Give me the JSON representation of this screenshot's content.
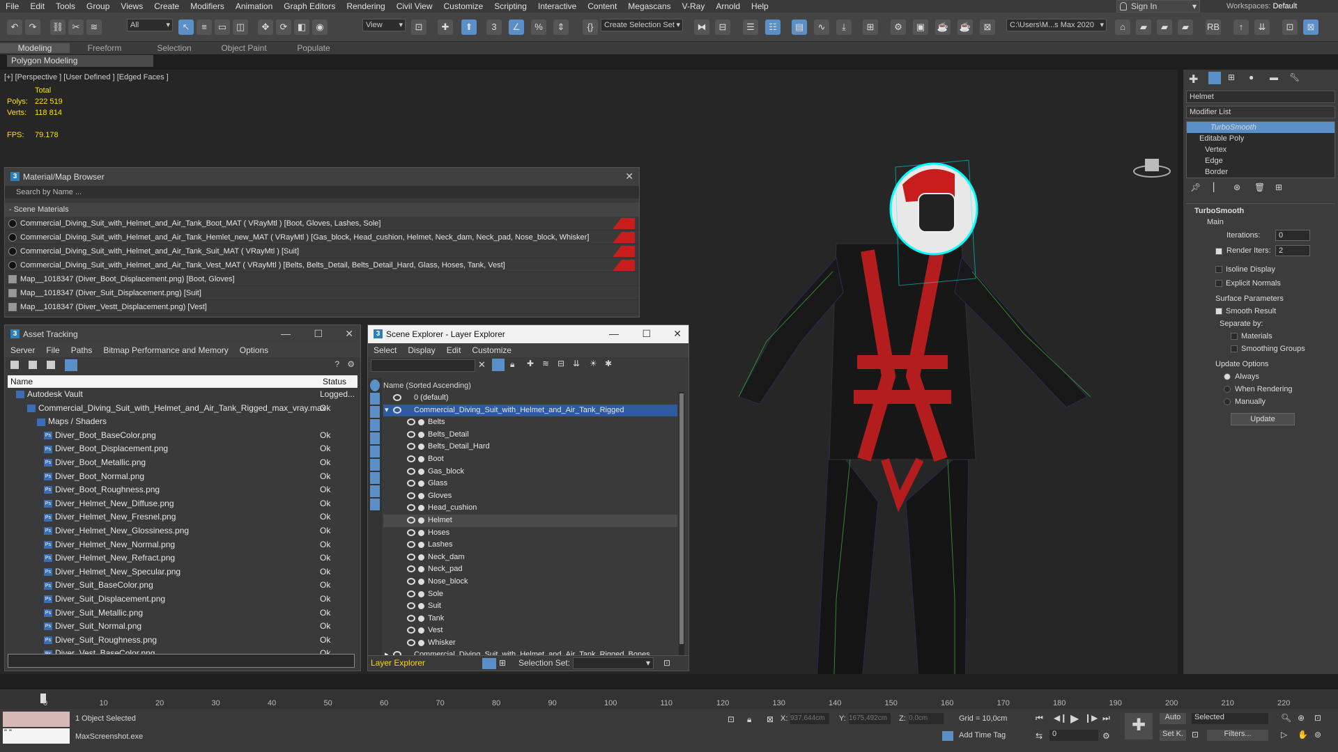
{
  "menu": [
    "File",
    "Edit",
    "Tools",
    "Group",
    "Views",
    "Create",
    "Modifiers",
    "Animation",
    "Graph Editors",
    "Rendering",
    "Civil View",
    "Customize",
    "Scripting",
    "Interactive",
    "Content",
    "Megascans",
    "V-Ray",
    "Arnold",
    "Help"
  ],
  "signin": "Sign In",
  "workspaces": "Workspaces:",
  "workspace_value": "Default",
  "toolbar": {
    "filter": "All",
    "view": "View",
    "selection_set": "Create Selection Set",
    "path": "C:\\Users\\M...s Max 2020"
  },
  "ribbon": {
    "tabs": [
      "Modeling",
      "Freeform",
      "Selection",
      "Object Paint",
      "Populate"
    ],
    "active": "Modeling",
    "subpanel": "Polygon Modeling"
  },
  "viewport": {
    "label": "[+] [Perspective ] [User Defined ] [Edged Faces ]",
    "stats_header": "Total",
    "polys_label": "Polys:",
    "polys": "222 519",
    "verts_label": "Verts:",
    "verts": "118 814",
    "fps_label": "FPS:",
    "fps": "79.178"
  },
  "material_browser": {
    "title": "Material/Map Browser",
    "search": "Search by Name ...",
    "section": "- Scene Materials",
    "items": [
      "Commercial_Diving_Suit_with_Helmet_and_Air_Tank_Boot_MAT  ( VRayMtl )  [Boot, Gloves, Lashes, Sole]",
      "Commercial_Diving_Suit_with_Helmet_and_Air_Tank_Hemlet_new_MAT  ( VRayMtl )  [Gas_block, Head_cushion, Helmet, Neck_dam, Neck_pad, Nose_block, Whisker]",
      "Commercial_Diving_Suit_with_Helmet_and_Air_Tank_Suit_MAT  ( VRayMtl )  [Suit]",
      "Commercial_Diving_Suit_with_Helmet_and_Air_Tank_Vest_MAT  ( VRayMtl )  [Belts, Belts_Detail, Belts_Detail_Hard, Glass, Hoses, Tank, Vest]",
      "Map__1018347 (Diver_Boot_Displacement.png)  [Boot, Gloves]",
      "Map__1018347 (Diver_Suit_Displacement.png)  [Suit]",
      "Map__1018347 (Diver_Vestt_Displacement.png)  [Vest]"
    ]
  },
  "asset_tracking": {
    "title": "Asset Tracking",
    "menu": [
      "Server",
      "File",
      "Paths",
      "Bitmap Performance and Memory",
      "Options"
    ],
    "col_name": "Name",
    "col_status": "Status",
    "rows": [
      {
        "name": "Autodesk Vault",
        "status": "Logged..."
      },
      {
        "name": "Commercial_Diving_Suit_with_Helmet_and_Air_Tank_Rigged_max_vray.max",
        "status": "Ok"
      },
      {
        "name": "Maps / Shaders",
        "status": ""
      },
      {
        "name": "Diver_Boot_BaseColor.png",
        "status": "Ok"
      },
      {
        "name": "Diver_Boot_Displacement.png",
        "status": "Ok"
      },
      {
        "name": "Diver_Boot_Metallic.png",
        "status": "Ok"
      },
      {
        "name": "Diver_Boot_Normal.png",
        "status": "Ok"
      },
      {
        "name": "Diver_Boot_Roughness.png",
        "status": "Ok"
      },
      {
        "name": "Diver_Helmet_New_Diffuse.png",
        "status": "Ok"
      },
      {
        "name": "Diver_Helmet_New_Fresnel.png",
        "status": "Ok"
      },
      {
        "name": "Diver_Helmet_New_Glossiness.png",
        "status": "Ok"
      },
      {
        "name": "Diver_Helmet_New_Normal.png",
        "status": "Ok"
      },
      {
        "name": "Diver_Helmet_New_Refract.png",
        "status": "Ok"
      },
      {
        "name": "Diver_Helmet_New_Specular.png",
        "status": "Ok"
      },
      {
        "name": "Diver_Suit_BaseColor.png",
        "status": "Ok"
      },
      {
        "name": "Diver_Suit_Displacement.png",
        "status": "Ok"
      },
      {
        "name": "Diver_Suit_Metallic.png",
        "status": "Ok"
      },
      {
        "name": "Diver_Suit_Normal.png",
        "status": "Ok"
      },
      {
        "name": "Diver_Suit_Roughness.png",
        "status": "Ok"
      },
      {
        "name": "Diver_Vest_BaseColor.png",
        "status": "Ok"
      }
    ]
  },
  "scene_explorer": {
    "title": "Scene Explorer - Layer Explorer",
    "menu": [
      "Select",
      "Display",
      "Edit",
      "Customize"
    ],
    "header": "Name (Sorted Ascending)",
    "layer0": "0 (default)",
    "group": "Commercial_Diving_Suit_with_Helmet_and_Air_Tank_Rigged",
    "items": [
      "Belts",
      "Belts_Detail",
      "Belts_Detail_Hard",
      "Boot",
      "Gas_block",
      "Glass",
      "Gloves",
      "Head_cushion",
      "Helmet",
      "Hoses",
      "Lashes",
      "Neck_dam",
      "Neck_pad",
      "Nose_block",
      "Sole",
      "Suit",
      "Tank",
      "Vest",
      "Whisker"
    ],
    "selected": "Helmet",
    "bones": "Commercial_Diving_Suit_with_Helmet_and_Air_Tank_Rigged_Bones",
    "footer_layer": "Layer Explorer",
    "selection_set": "Selection Set:"
  },
  "command_panel": {
    "object_name": "Helmet",
    "modifier_list": "Modifier List",
    "stack": [
      "TurboSmooth",
      "Editable Poly",
      "Vertex",
      "Edge",
      "Border"
    ],
    "rollout": "TurboSmooth",
    "main": "Main",
    "iterations_label": "Iterations:",
    "iterations": "0",
    "render_iters_label": "Render Iters:",
    "render_iters": "2",
    "isoline": "Isoline Display",
    "explicit": "Explicit Normals",
    "surface": "Surface Parameters",
    "smooth": "Smooth Result",
    "separate": "Separate by:",
    "materials": "Materials",
    "smoothing": "Smoothing Groups",
    "update_options": "Update Options",
    "always": "Always",
    "when_rendering": "When Rendering",
    "manually": "Manually",
    "update": "Update"
  },
  "timeline": {
    "ticks": [
      "0",
      "10",
      "20",
      "30",
      "40",
      "50",
      "60",
      "70",
      "80",
      "90",
      "100",
      "110",
      "120",
      "130",
      "140",
      "150",
      "160",
      "170",
      "180",
      "190",
      "200",
      "210",
      "220"
    ]
  },
  "status": {
    "selected": "1 Object Selected",
    "script": "MaxScreenshot.exe",
    "x_label": "X:",
    "x": "937,644cm",
    "y_label": "Y:",
    "y": "1675,492cm",
    "z_label": "Z:",
    "z": "0,0cm",
    "grid": "Grid = 10,0cm",
    "add_time_tag": "Add Time Tag",
    "auto": "Auto",
    "setk": "Set K.",
    "selected_dd": "Selected",
    "filters": "Filters...",
    "frame": "0"
  },
  "colors": {
    "accent": "#5b8fc7",
    "selection": "#2f5a9e",
    "red": "#c81d1d"
  }
}
